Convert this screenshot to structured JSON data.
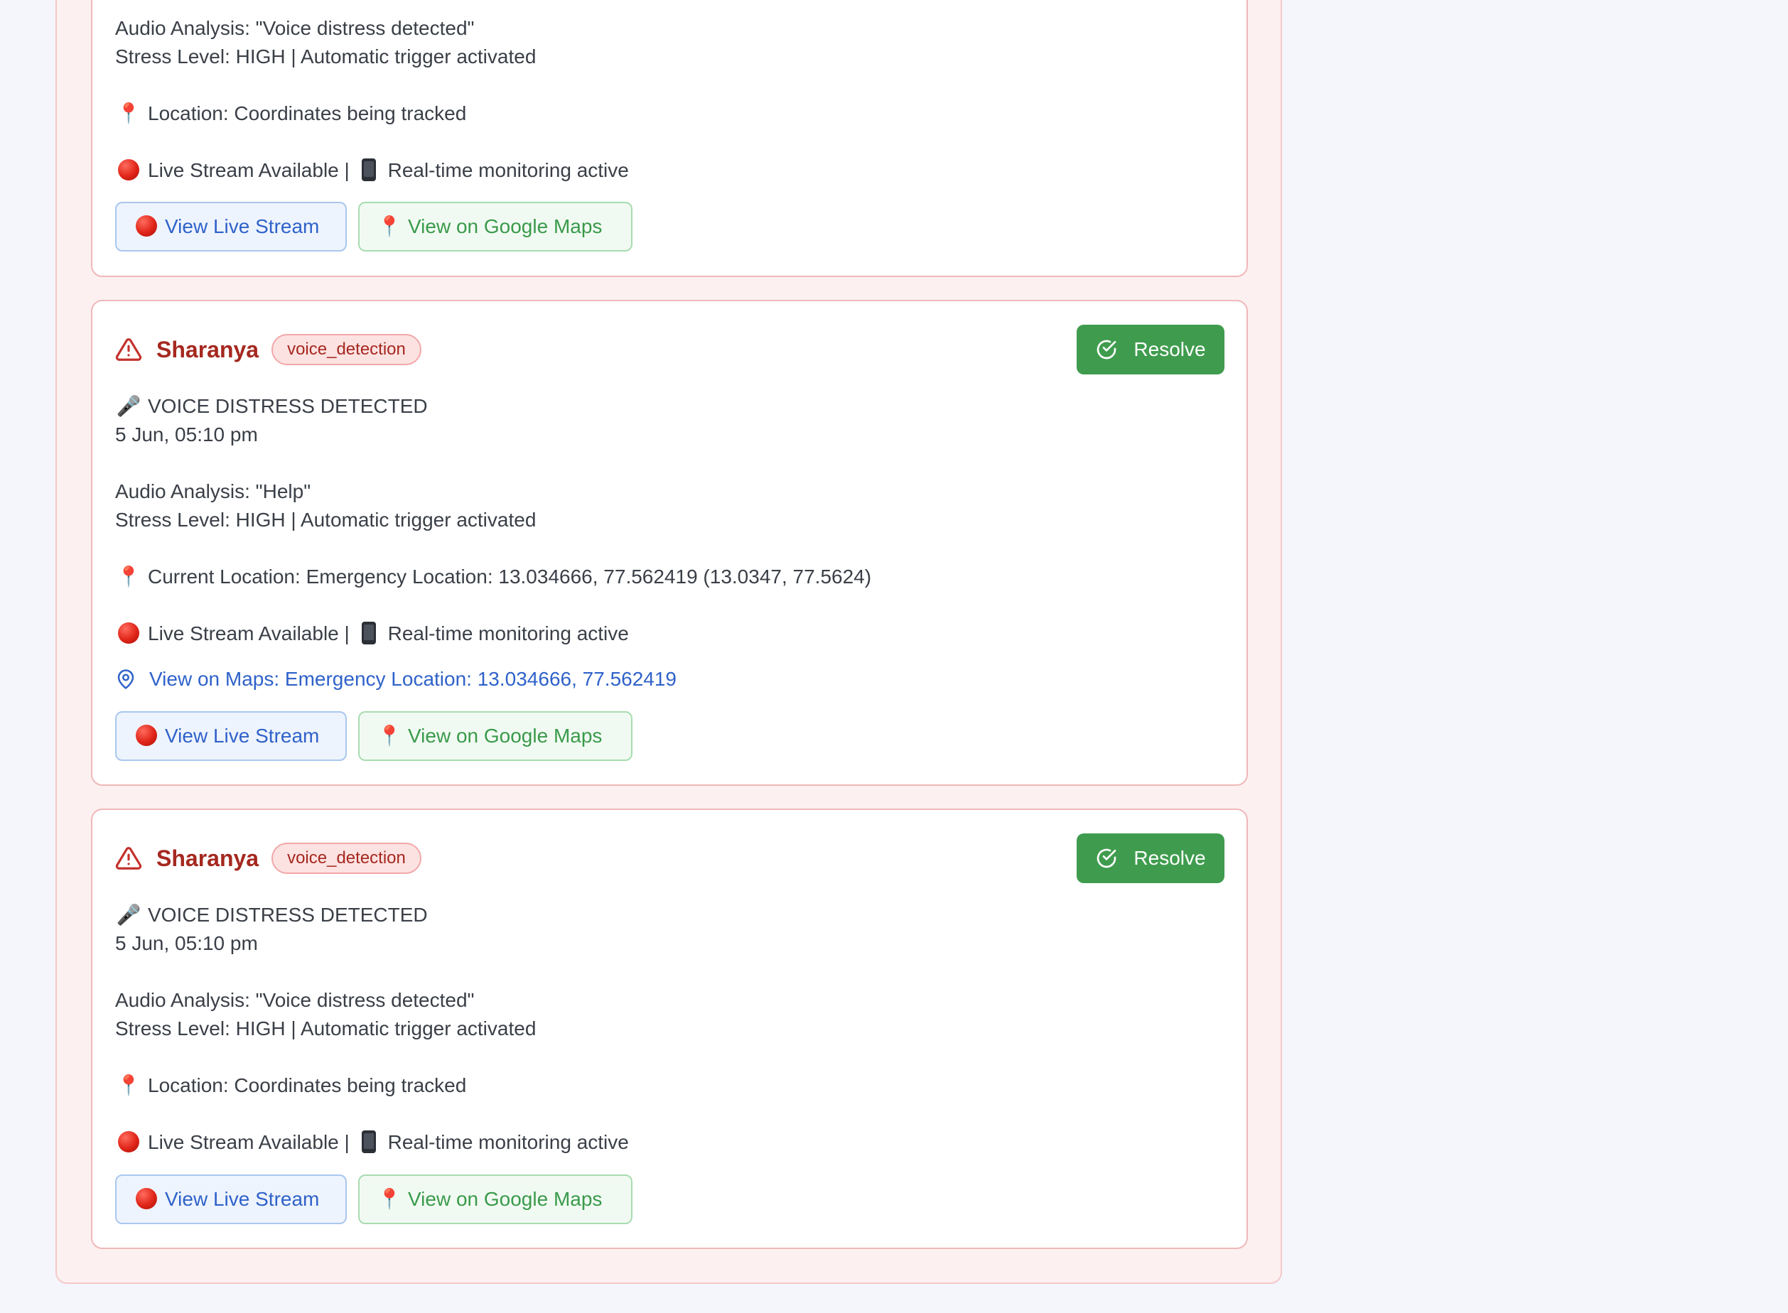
{
  "alerts": [
    {
      "audio_analysis": "Audio Analysis: \"Voice distress detected\"",
      "stress_level": "Stress Level: HIGH | Automatic trigger activated",
      "location": "Location: Coordinates being tracked",
      "stream_status_a": "Live Stream Available |",
      "stream_status_b": "Real-time monitoring active",
      "view_stream_label": "View Live Stream",
      "view_maps_label": "View on Google Maps"
    },
    {
      "name": "Sharanya",
      "badge": "voice_detection",
      "resolve_label": "Resolve",
      "headline": "VOICE DISTRESS DETECTED",
      "timestamp": "5 Jun, 05:10 pm",
      "audio_analysis": "Audio Analysis: \"Help\"",
      "stress_level": "Stress Level: HIGH | Automatic trigger activated",
      "location": "Current Location: Emergency Location: 13.034666, 77.562419 (13.0347, 77.5624)",
      "stream_status_a": "Live Stream Available |",
      "stream_status_b": "Real-time monitoring active",
      "maps_link": "View on Maps: Emergency Location: 13.034666, 77.562419",
      "view_stream_label": "View Live Stream",
      "view_maps_label": "View on Google Maps"
    },
    {
      "name": "Sharanya",
      "badge": "voice_detection",
      "resolve_label": "Resolve",
      "headline": "VOICE DISTRESS DETECTED",
      "timestamp": "5 Jun, 05:10 pm",
      "audio_analysis": "Audio Analysis: \"Voice distress detected\"",
      "stress_level": "Stress Level: HIGH | Automatic trigger activated",
      "location": "Location: Coordinates being tracked",
      "stream_status_a": "Live Stream Available |",
      "stream_status_b": "Real-time monitoring active",
      "view_stream_label": "View Live Stream",
      "view_maps_label": "View on Google Maps"
    }
  ],
  "icons": {
    "warning": "warning-triangle-icon",
    "resolve": "check-circle-icon",
    "location": "location-pin-icon",
    "live": "red-circle-icon",
    "phone": "mobile-phone-icon",
    "mic": "microphone-icon",
    "map_marker": "map-marker-outline-icon"
  },
  "colors": {
    "alert_red": "#a5281f",
    "resolve_green": "#3f9c4e",
    "link_blue": "#2f62c9",
    "maps_green": "#3a9a4b"
  }
}
